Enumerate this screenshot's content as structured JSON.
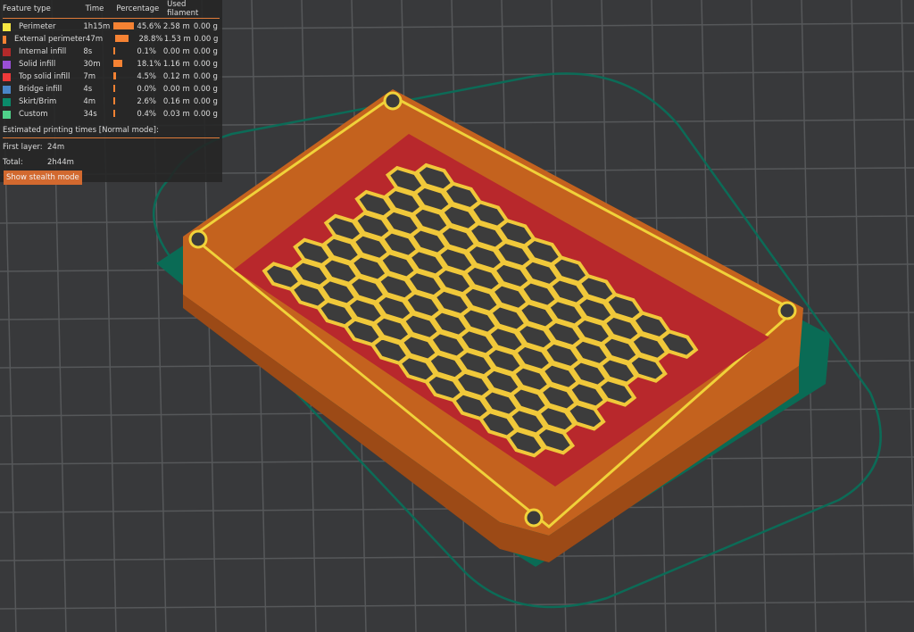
{
  "legend": {
    "headers": {
      "feature_type": "Feature type",
      "time": "Time",
      "percentage": "Percentage",
      "used_filament": "Used filament"
    },
    "rows": [
      {
        "name": "Perimeter",
        "time": "1h15m",
        "percent": 45.6,
        "percent_label": "45.6%",
        "length": "2.58 m",
        "weight": "0.00 g",
        "color": "#f7e742"
      },
      {
        "name": "External perimeter",
        "time": "47m",
        "percent": 28.8,
        "percent_label": "28.8%",
        "length": "1.53 m",
        "weight": "0.00 g",
        "color": "#f58233"
      },
      {
        "name": "Internal infill",
        "time": "8s",
        "percent": 0.1,
        "percent_label": "0.1%",
        "length": "0.00 m",
        "weight": "0.00 g",
        "color": "#b22a2a"
      },
      {
        "name": "Solid infill",
        "time": "30m",
        "percent": 18.1,
        "percent_label": "18.1%",
        "length": "1.16 m",
        "weight": "0.00 g",
        "color": "#9a4fd6"
      },
      {
        "name": "Top solid infill",
        "time": "7m",
        "percent": 4.5,
        "percent_label": "4.5%",
        "length": "0.12 m",
        "weight": "0.00 g",
        "color": "#ee3a3a"
      },
      {
        "name": "Bridge infill",
        "time": "4s",
        "percent": 0.0,
        "percent_label": "0.0%",
        "length": "0.00 m",
        "weight": "0.00 g",
        "color": "#4a86c8"
      },
      {
        "name": "Skirt/Brim",
        "time": "4m",
        "percent": 2.6,
        "percent_label": "2.6%",
        "length": "0.16 m",
        "weight": "0.00 g",
        "color": "#0b8a6a"
      },
      {
        "name": "Custom",
        "time": "34s",
        "percent": 0.4,
        "percent_label": "0.4%",
        "length": "0.03 m",
        "weight": "0.00 g",
        "color": "#4fd28a"
      }
    ],
    "estimated_title": "Estimated printing times [Normal mode]:",
    "first_layer_label": "First layer:",
    "first_layer_value": "24m",
    "total_label": "Total:",
    "total_value": "2h44m",
    "stealth_button": "Show stealth mode"
  }
}
